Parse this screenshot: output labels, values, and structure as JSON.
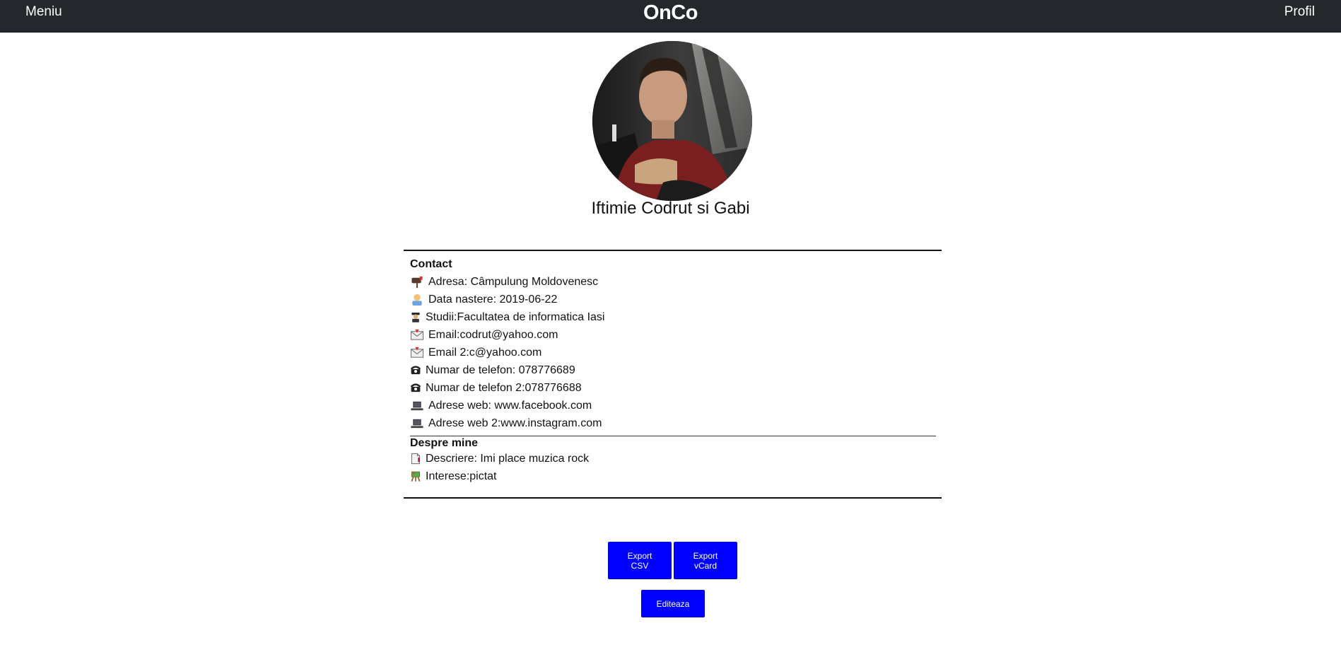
{
  "nav": {
    "menu_label": "Meniu",
    "logo": "OnCo",
    "profile_label": "Profil"
  },
  "profile": {
    "name": "Iftimie Codrut si Gabi",
    "photo_alt": "profile photo"
  },
  "contact": {
    "title": "Contact",
    "rows": [
      {
        "icon": "mailbox-icon",
        "text": "Adresa: Câmpulung Moldovenesc"
      },
      {
        "icon": "baby-icon",
        "text": "Data nastere: 2019-06-22"
      },
      {
        "icon": "student-icon",
        "text": "Studii:Facultatea de informatica Iasi"
      },
      {
        "icon": "envelope-icon",
        "text": "Email:codrut@yahoo.com"
      },
      {
        "icon": "envelope-icon",
        "text": "Email 2:c@yahoo.com"
      },
      {
        "icon": "phone-icon",
        "text": "Numar de telefon: 078776689"
      },
      {
        "icon": "phone-icon",
        "text": "Numar de telefon 2:078776688"
      },
      {
        "icon": "laptop-icon",
        "text": "Adrese web: www.facebook.com"
      },
      {
        "icon": "laptop-icon",
        "text": "Adrese web 2:www.instagram.com"
      }
    ]
  },
  "about": {
    "title": "Despre mine",
    "rows": [
      {
        "icon": "page-icon",
        "text": "Descriere: Imi place muzica rock"
      },
      {
        "icon": "easel-icon",
        "text": "Interese:pictat"
      }
    ]
  },
  "actions": {
    "export_csv": [
      "Export",
      "CSV"
    ],
    "export_vcard": [
      "Export",
      "vCard"
    ],
    "edit": "Editeaza"
  },
  "colors": {
    "topbar": "#24282c",
    "button": "#0000ff"
  }
}
